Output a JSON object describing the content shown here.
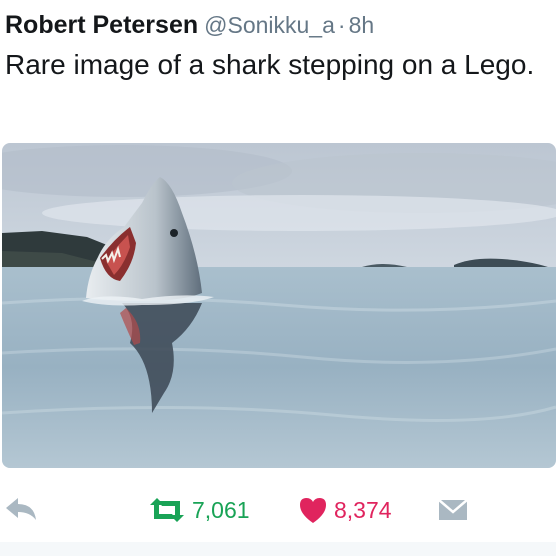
{
  "tweet": {
    "author_name": "Robert Petersen",
    "author_handle": "@Sonikku_a",
    "separator": "·",
    "timestamp": "8h",
    "text": "Rare image of a shark stepping on a Lego."
  },
  "media": {
    "subject": "shark breaching with open mouth in calm sea",
    "sky_color": "#c9d3dd",
    "water_color": "#9fb8c9"
  },
  "actions": {
    "reply_icon": "reply-arrow-icon",
    "retweet_icon": "retweet-icon",
    "retweet_count": "7,061",
    "like_icon": "heart-icon",
    "like_count": "8,374",
    "message_icon": "envelope-icon"
  },
  "colors": {
    "text": "#14171a",
    "muted": "#657786",
    "retweet_green": "#19a356",
    "like_red": "#e0245e",
    "icon_gray": "#aab8c2"
  }
}
